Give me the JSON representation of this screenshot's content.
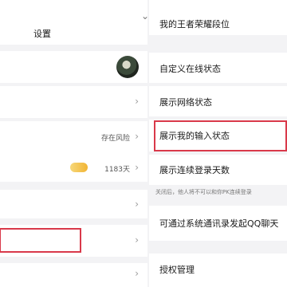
{
  "left": {
    "title": "设置",
    "top_chevron": "⌄",
    "rows": [
      {
        "value": "",
        "arrow": "›"
      },
      {
        "value": "",
        "arrow": "›"
      },
      {
        "value": "存在风险",
        "arrow": "›"
      },
      {
        "value": "1183天",
        "arrow": "›"
      },
      {
        "value": "",
        "arrow": "›"
      },
      {
        "value": "",
        "arrow": "›"
      },
      {
        "value": "",
        "arrow": "›"
      }
    ]
  },
  "right": {
    "rows": [
      "我的王者荣耀段位",
      "自定义在线状态",
      "展示网络状态",
      "展示我的输入状态",
      "展示连续登录天数",
      "可通过系统通讯录发起QQ聊天",
      "授权管理"
    ],
    "note": "关闭后，他人将不可以和你PK连续登录"
  },
  "colors": {
    "highlight": "#d9394a",
    "badge": "#f2b534"
  },
  "icons": [
    "chevron-down-icon",
    "chevron-right-icon"
  ]
}
